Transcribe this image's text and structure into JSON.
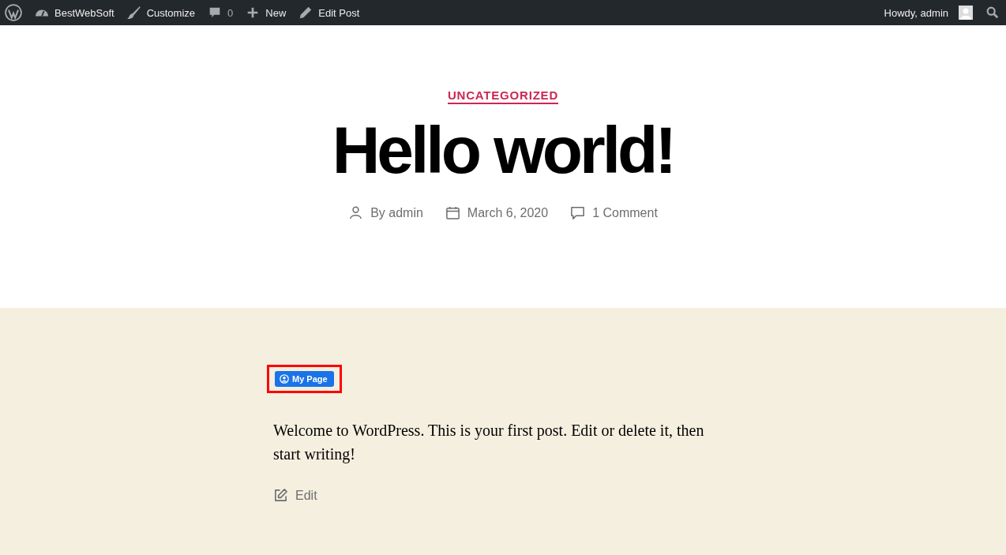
{
  "admin_bar": {
    "left": [
      {
        "kind": "logo"
      },
      {
        "kind": "site",
        "label": "BestWebSoft"
      },
      {
        "kind": "customize",
        "label": "Customize"
      },
      {
        "kind": "comments",
        "label": "0"
      },
      {
        "kind": "new",
        "label": "New"
      },
      {
        "kind": "edit",
        "label": "Edit Post"
      }
    ],
    "greeting": "Howdy, admin"
  },
  "post": {
    "category": "UNCATEGORIZED",
    "title": "Hello world!",
    "meta": [
      {
        "kind": "author",
        "label": "By admin"
      },
      {
        "kind": "date",
        "label": "March 6, 2020"
      },
      {
        "kind": "comments",
        "label": "1 Comment"
      }
    ]
  },
  "content": {
    "button": {
      "label": "My Page",
      "highlighted": true
    },
    "paragraph": "Welcome to WordPress. This is your first post. Edit or delete it, then start writing!",
    "edit_link": "Edit"
  }
}
